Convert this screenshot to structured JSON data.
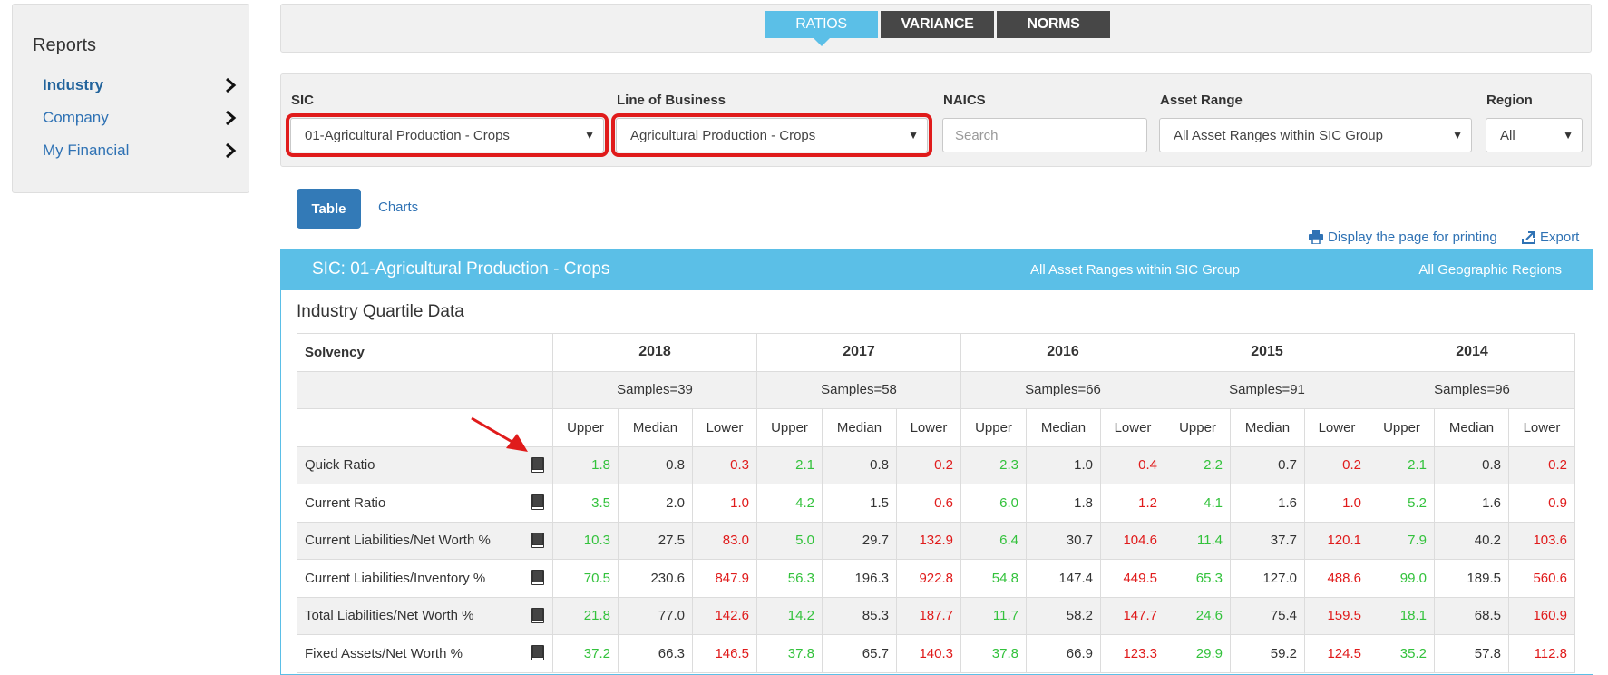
{
  "sidebar": {
    "title": "Reports",
    "items": [
      {
        "label": "Industry",
        "active": true
      },
      {
        "label": "Company"
      },
      {
        "label": "My Financial"
      }
    ]
  },
  "top_tabs": [
    "RATIOS",
    "VARIANCE",
    "NORMS"
  ],
  "filters": {
    "sic_label": "SIC",
    "sic_value": "01-Agricultural Production - Crops",
    "lob_label": "Line of Business",
    "lob_value": "Agricultural Production - Crops",
    "naics_label": "NAICS",
    "naics_placeholder": "Search",
    "asset_label": "Asset Range",
    "asset_value": "All Asset Ranges within SIC Group",
    "region_label": "Region",
    "region_value": "All"
  },
  "view": {
    "table": "Table",
    "charts": "Charts"
  },
  "actions": {
    "print": "Display the page for printing",
    "export": "Export"
  },
  "panel": {
    "sic": "SIC: 01-Agricultural Production - Crops",
    "asset": "All Asset Ranges within SIC Group",
    "region": "All Geographic Regions",
    "section_title": "Industry Quartile Data"
  },
  "table": {
    "category": "Solvency",
    "years": [
      "2018",
      "2017",
      "2016",
      "2015",
      "2014"
    ],
    "samples": [
      "Samples=39",
      "Samples=58",
      "Samples=66",
      "Samples=91",
      "Samples=96"
    ],
    "sub": [
      "Upper",
      "Median",
      "Lower"
    ],
    "rows": [
      {
        "label": "Quick Ratio",
        "values": [
          "1.8",
          "0.8",
          "0.3",
          "2.1",
          "0.8",
          "0.2",
          "2.3",
          "1.0",
          "0.4",
          "2.2",
          "0.7",
          "0.2",
          "2.1",
          "0.8",
          "0.2"
        ]
      },
      {
        "label": "Current Ratio",
        "values": [
          "3.5",
          "2.0",
          "1.0",
          "4.2",
          "1.5",
          "0.6",
          "6.0",
          "1.8",
          "1.2",
          "4.1",
          "1.6",
          "1.0",
          "5.2",
          "1.6",
          "0.9"
        ]
      },
      {
        "label": "Current Liabilities/Net Worth %",
        "values": [
          "10.3",
          "27.5",
          "83.0",
          "5.0",
          "29.7",
          "132.9",
          "6.4",
          "30.7",
          "104.6",
          "11.4",
          "37.7",
          "120.1",
          "7.9",
          "40.2",
          "103.6"
        ]
      },
      {
        "label": "Current Liabilities/Inventory %",
        "values": [
          "70.5",
          "230.6",
          "847.9",
          "56.3",
          "196.3",
          "922.8",
          "54.8",
          "147.4",
          "449.5",
          "65.3",
          "127.0",
          "488.6",
          "99.0",
          "189.5",
          "560.6"
        ]
      },
      {
        "label": "Total Liabilities/Net Worth %",
        "values": [
          "21.8",
          "77.0",
          "142.6",
          "14.2",
          "85.3",
          "187.7",
          "11.7",
          "58.2",
          "147.7",
          "24.6",
          "75.4",
          "159.5",
          "18.1",
          "68.5",
          "160.9"
        ]
      },
      {
        "label": "Fixed Assets/Net Worth %",
        "values": [
          "37.2",
          "66.3",
          "146.5",
          "37.8",
          "65.7",
          "140.3",
          "37.8",
          "66.9",
          "123.3",
          "29.9",
          "59.2",
          "124.5",
          "35.2",
          "57.8",
          "112.8"
        ]
      }
    ]
  },
  "colors": {
    "accent": "#5bbfe7",
    "upper": "#33c23c",
    "lower": "#e01b1b",
    "link": "#2f72b4"
  }
}
